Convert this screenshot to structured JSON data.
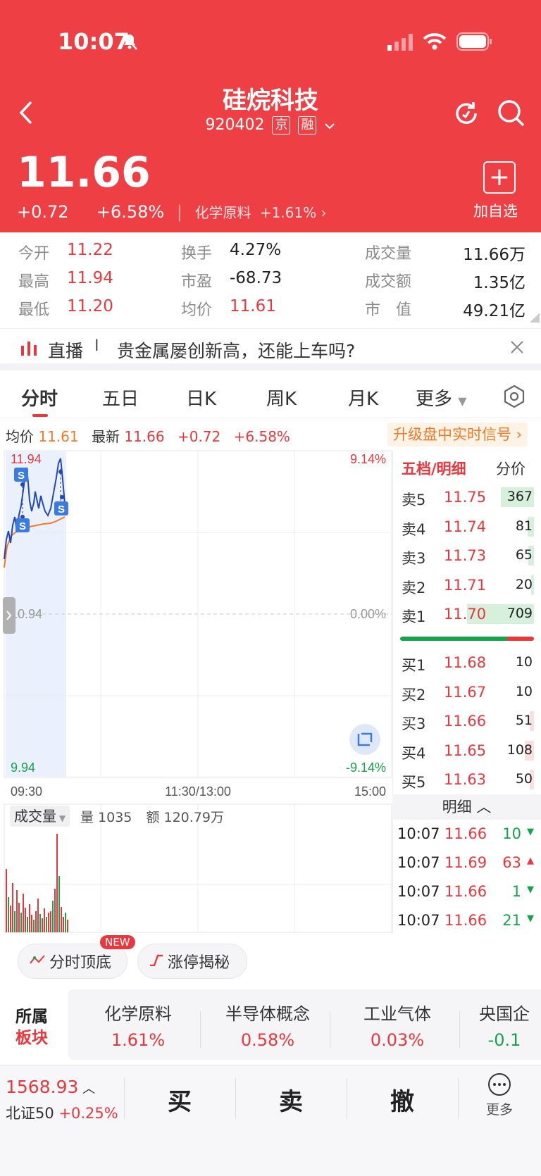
{
  "status": {
    "time": "10:07"
  },
  "header": {
    "title": "硅烷科技",
    "code": "920402",
    "tag1": "京",
    "tag2": "融",
    "price": "11.66",
    "change": "+0.72",
    "change_pct": "+6.58%",
    "sector_name": "化学原料",
    "sector_pct": "+1.61%",
    "add_label": "加自选"
  },
  "stats": {
    "open_label": "今开",
    "open": "11.22",
    "high_label": "最高",
    "high": "11.94",
    "low_label": "最低",
    "low": "11.20",
    "turnover_label": "换手",
    "turnover": "4.27%",
    "pe_label": "市盈",
    "pe": "-68.73",
    "avg_label": "均价",
    "avg": "11.61",
    "volume_label": "成交量",
    "volume": "11.66万",
    "amount_label": "成交额",
    "amount": "1.35亿",
    "mcap_label": "市　值",
    "mcap": "49.21亿"
  },
  "live": {
    "label": "直播",
    "separator": "I",
    "text": "贵金属屡创新高，还能上车吗?"
  },
  "tabs": [
    "分时",
    "五日",
    "日K",
    "周K",
    "月K",
    "更多"
  ],
  "infoline": {
    "avg_label": "均价",
    "avg": "11.61",
    "last_label": "最新",
    "last": "11.66",
    "chg": "+0.72",
    "pct": "+6.58%",
    "upgrade": "升级盘中实时信号"
  },
  "chart": {
    "y_top": "11.94",
    "y_mid": "10.94",
    "y_bot": "9.94",
    "pct_top": "9.14%",
    "pct_mid": "0.00%",
    "pct_bot": "-9.14%",
    "t_start": "09:30",
    "t_mid": "11:30/13:00",
    "t_end": "15:00",
    "signal": "S",
    "vol_selector": "成交量",
    "vol_label": "量 1035",
    "amt_label": "额 120.79万"
  },
  "book": {
    "title": "五档/明细",
    "title2": "分价",
    "asks": [
      {
        "label": "卖5",
        "price": "11.75",
        "vol": "367",
        "fill": 0.25
      },
      {
        "label": "卖4",
        "price": "11.74",
        "vol": "81",
        "fill": 0.05
      },
      {
        "label": "卖3",
        "price": "11.73",
        "vol": "65",
        "fill": 0.04
      },
      {
        "label": "卖2",
        "price": "11.71",
        "vol": "20",
        "fill": 0.02
      },
      {
        "label": "卖1",
        "price": "11.70",
        "vol": "709",
        "fill": 0.5
      }
    ],
    "bids": [
      {
        "label": "买1",
        "price": "11.68",
        "vol": "10",
        "fill": 0.0
      },
      {
        "label": "买2",
        "price": "11.67",
        "vol": "10",
        "fill": 0.0
      },
      {
        "label": "买3",
        "price": "11.66",
        "vol": "51",
        "fill": 0.03
      },
      {
        "label": "买4",
        "price": "11.65",
        "vol": "108",
        "fill": 0.07
      },
      {
        "label": "买5",
        "price": "11.63",
        "vol": "50",
        "fill": 0.03
      }
    ],
    "detail_label": "明细",
    "ticks": [
      {
        "time": "10:07",
        "price": "11.66",
        "vol": "10",
        "dir": "down"
      },
      {
        "time": "10:07",
        "price": "11.69",
        "vol": "63",
        "dir": "up"
      },
      {
        "time": "10:07",
        "price": "11.66",
        "vol": "1",
        "dir": "down"
      },
      {
        "time": "10:07",
        "price": "11.66",
        "vol": "21",
        "dir": "down"
      }
    ]
  },
  "features": {
    "f1": "分时顶底",
    "f1_badge": "NEW",
    "f2": "涨停揭秘"
  },
  "sectors": {
    "label1": "所属",
    "label2": "板块",
    "items": [
      {
        "name": "化学原料",
        "pct": "1.61%"
      },
      {
        "name": "半导体概念",
        "pct": "0.58%"
      },
      {
        "name": "工业气体",
        "pct": "0.03%"
      },
      {
        "name": "央国企",
        "pct": "-0.1"
      }
    ]
  },
  "bottom": {
    "index_value": "1568.93",
    "index_name": "北证50",
    "index_pct": "+0.25%",
    "buy": "买",
    "sell": "卖",
    "cancel": "撤",
    "more": "更多"
  },
  "colors": {
    "red": "#ee3f44",
    "green": "#16a34a",
    "price_line": "#2247b8",
    "avg_line": "#f07a2a"
  }
}
